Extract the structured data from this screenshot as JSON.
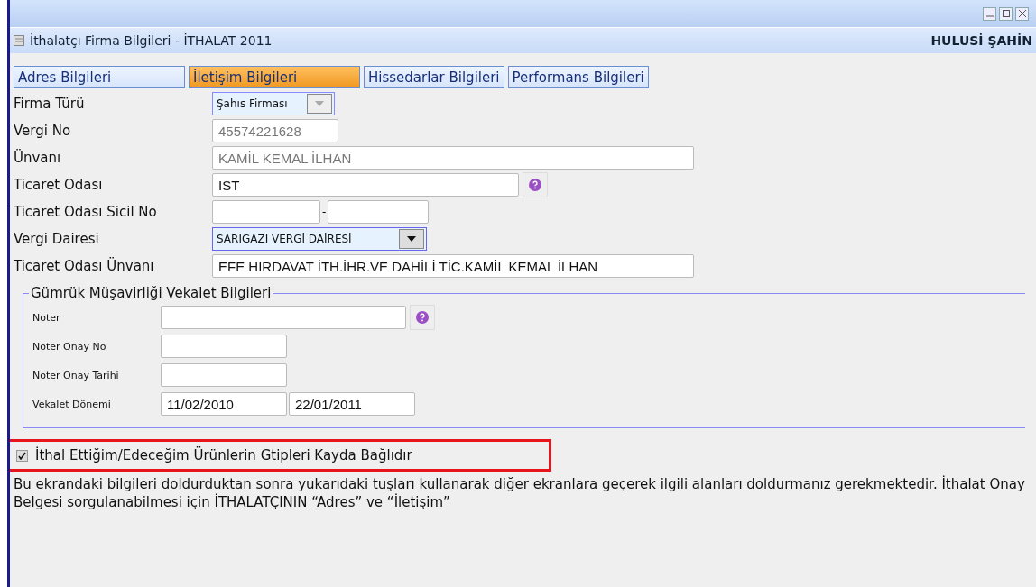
{
  "window": {
    "title": "İthalatçı Firma Bilgileri - İTHALAT 2011",
    "user": "HULUSİ ŞAHİN"
  },
  "tabs": [
    {
      "label": "Adres Bilgileri",
      "selected": false
    },
    {
      "label": "İletişim Bilgileri",
      "selected": true
    },
    {
      "label": "Hissedarlar Bilgileri",
      "selected": false
    },
    {
      "label": "Performans Bilgileri",
      "selected": false
    }
  ],
  "fields": [
    {
      "label": "Firma Türü",
      "kind": "select",
      "values": [
        "Şahıs Firması"
      ],
      "disabled": true
    },
    {
      "label": "Vergi No",
      "kind": "short_text",
      "values": [
        "45574221628"
      ],
      "disabled": true
    },
    {
      "label": "Ünvanı",
      "kind": "long_text",
      "values": [
        "KAMİL KEMAL İLHAN"
      ],
      "disabled": true
    },
    {
      "label": "Ticaret Odası",
      "kind": "lookup",
      "values": [
        "IST"
      ]
    },
    {
      "label": "Ticaret Odası Sicil No",
      "kind": "pair",
      "separator": "-"
    },
    {
      "label": "Vergi Dairesi",
      "kind": "select",
      "values": [
        "SARIGAZI VERGİ DAİRESİ"
      ],
      "disabled": false
    },
    {
      "label": "Ticaret Odası Ünvanı",
      "kind": "long_text",
      "values": [
        "EFE HIRDAVAT İTH.İHR.VE DAHİLİ TİC.KAMİL KEMAL İLHAN"
      ],
      "disabled": false
    }
  ],
  "proxy": {
    "legend": "Gümrük Müşavirliği Vekalet Bilgileri",
    "rows": [
      {
        "label": "Noter",
        "kind": "lookup"
      },
      {
        "label": "Noter Onay No",
        "kind": "short_text"
      },
      {
        "label": "Noter Onay Tarihi",
        "kind": "short_text"
      },
      {
        "label": "Vekalet Dönemi",
        "kind": "pair",
        "values": [
          "11/02/2010",
          "22/01/2011"
        ]
      }
    ]
  },
  "gtip_checkbox": {
    "label": "İthal Ettiğim/Edeceğim Ürünlerin Gtipleri Kayda Bağlıdır",
    "checked": true,
    "highlighted": true
  },
  "note": "Bu ekrandaki bilgileri doldurduktan sonra yukarıdaki tuşları kullanarak diğer ekranlara geçerek ilgili alanları doldurmanız gerekmektedir. İthalat Onay Belgesi sorgulanabilmesi için İTHALATÇININ “Adres” ve “İletişim”"
}
